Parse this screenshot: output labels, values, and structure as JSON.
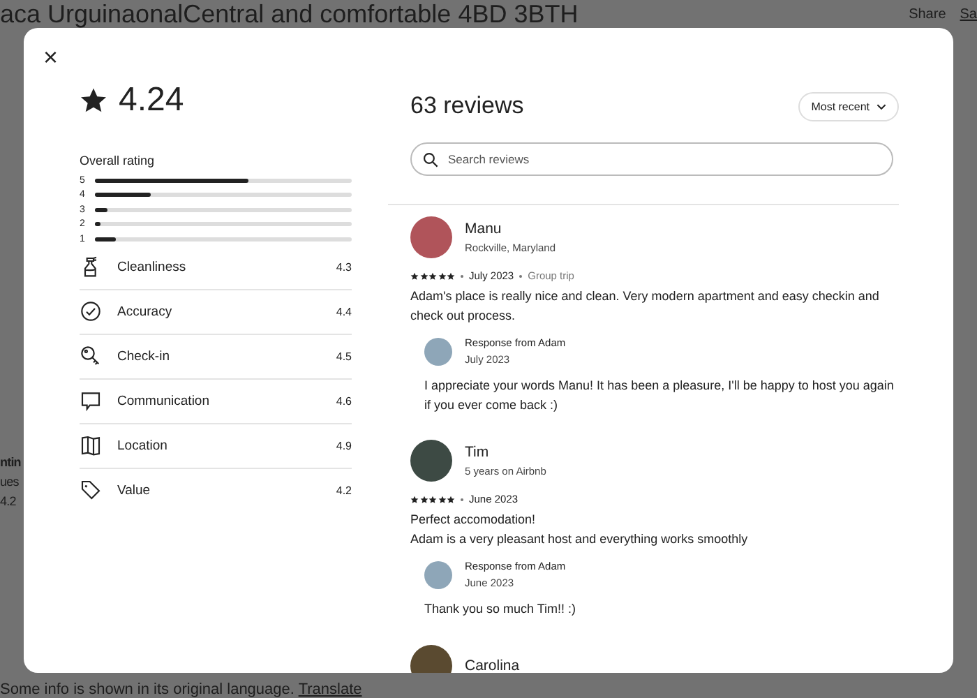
{
  "page": {
    "title": "aca UrguinaonalCentral and comfortable 4BD 3BTH",
    "share": "Share",
    "save": "Sa",
    "side_fragments": [
      "ntin",
      "ues",
      "4.2"
    ],
    "footer_note": "Some info is shown in its original language.",
    "footer_link": "Translate"
  },
  "modal": {
    "close": "×",
    "summary": {
      "rating": "4.24",
      "overall_label": "Overall rating",
      "distribution": [
        {
          "label": "5",
          "level": 0.6
        },
        {
          "label": "4",
          "level": 0.22
        },
        {
          "label": "3",
          "level": 0.05
        },
        {
          "label": "2",
          "level": 0.02
        },
        {
          "label": "1",
          "level": 0.08
        }
      ],
      "categories": [
        {
          "kind": "cleanliness",
          "label": "Cleanliness",
          "score": "4.3"
        },
        {
          "kind": "accuracy",
          "label": "Accuracy",
          "score": "4.4"
        },
        {
          "kind": "checkin",
          "label": "Check-in",
          "score": "4.5"
        },
        {
          "kind": "communication",
          "label": "Communication",
          "score": "4.6"
        },
        {
          "kind": "location",
          "label": "Location",
          "score": "4.9"
        },
        {
          "kind": "value",
          "label": "Value",
          "score": "4.2"
        }
      ]
    },
    "reviews_title": "63 reviews",
    "sort": "Most recent",
    "search": {
      "placeholder": "Search reviews"
    },
    "reviews": [
      {
        "name": "Manu",
        "subtitle": "Rockville, Maryland",
        "stars": 5,
        "date": "July 2023",
        "trip": "Group trip",
        "text": [
          "Adam's place is really nice and clean. Very modern apartment and easy checkin and check out process."
        ],
        "response": {
          "title": "Response from Adam",
          "date": "July 2023",
          "text": "I appreciate your words Manu! It has been a pleasure, I'll be happy to host you again if you ever come back :)"
        }
      },
      {
        "name": "Tim",
        "subtitle": "5 years on Airbnb",
        "stars": 5,
        "date": "June 2023",
        "text": [
          "Perfect accomodation!",
          "Adam is a very pleasant host and everything works smoothly"
        ],
        "response": {
          "title": "Response from Adam",
          "date": "June 2023",
          "text": "Thank you so much Tim!! :)"
        }
      },
      {
        "name": "Carolina"
      }
    ]
  }
}
